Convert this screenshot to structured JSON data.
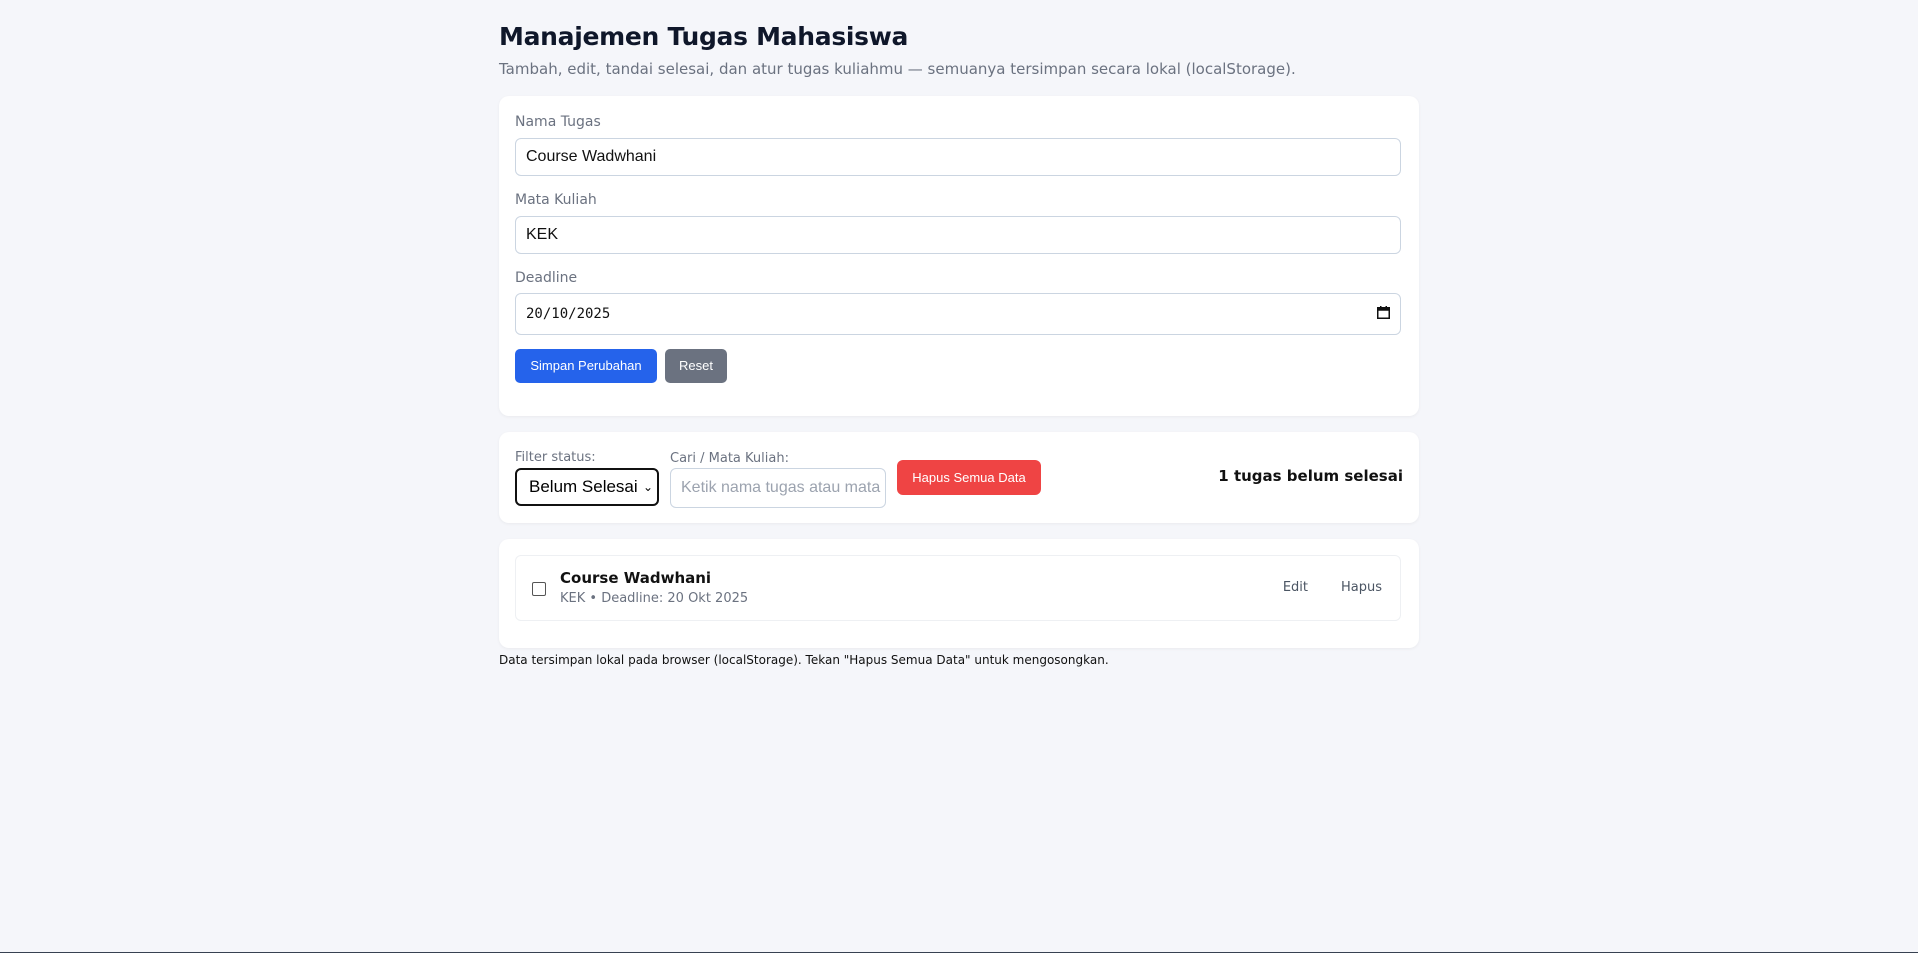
{
  "header": {
    "title": "Manajemen Tugas Mahasiswa",
    "subtitle": "Tambah, edit, tandai selesai, dan atur tugas kuliahmu — semuanya tersimpan secara lokal (localStorage)."
  },
  "form": {
    "task_label": "Nama Tugas",
    "task_value": "Course Wadwhani",
    "course_label": "Mata Kuliah",
    "course_value": "KEK",
    "deadline_label": "Deadline",
    "deadline_value": "20/10/2025",
    "save_label": "Simpan Perubahan",
    "reset_label": "Reset"
  },
  "filters": {
    "status_label": "Filter status:",
    "status_value": "Belum Selesai",
    "search_label": "Cari / Mata Kuliah:",
    "search_placeholder": "Ketik nama tugas atau mata kuliah",
    "clear_label": "Hapus Semua Data",
    "summary": "1 tugas belum selesai"
  },
  "tasks": [
    {
      "title": "Course Wadwhani",
      "meta": "KEK • Deadline: 20 Okt 2025",
      "done": false,
      "edit_label": "Edit",
      "delete_label": "Hapus"
    }
  ],
  "footer": "Data tersimpan lokal pada browser (localStorage). Tekan \"Hapus Semua Data\" untuk mengosongkan.",
  "colors": {
    "primary": "#2563eb",
    "secondary": "#6b7280",
    "danger": "#ef4444",
    "background": "#f5f6fa"
  }
}
